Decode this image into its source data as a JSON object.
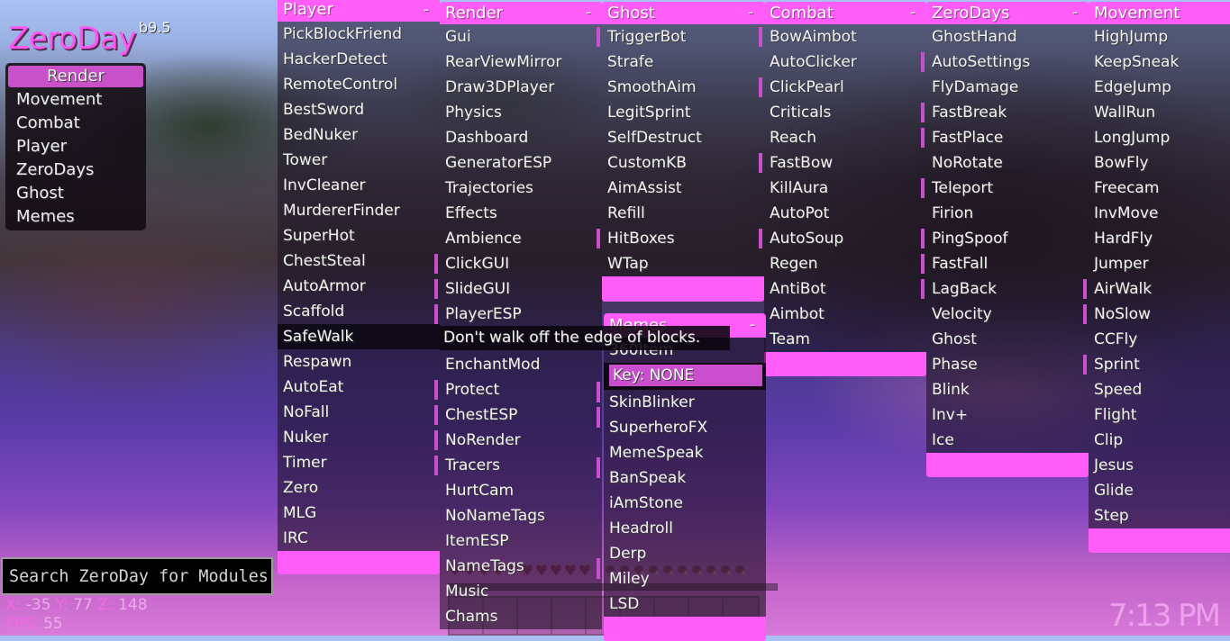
{
  "app": {
    "title": "ZeroDay",
    "version": "b9.5"
  },
  "colors": {
    "accent": "#ff5cf8",
    "enabled_indicator": "#c94fcf",
    "selected_category": "#c850c8",
    "logo": "#ff55f2"
  },
  "sidebar": {
    "categories": [
      {
        "label": "Render",
        "selected": true
      },
      {
        "label": "Movement"
      },
      {
        "label": "Combat"
      },
      {
        "label": "Player"
      },
      {
        "label": "ZeroDays"
      },
      {
        "label": "Ghost"
      },
      {
        "label": "Memes"
      }
    ]
  },
  "panels": [
    {
      "id": "player",
      "title": "Player",
      "collapse_symbol": "-",
      "items": [
        {
          "label": "PickBlockFriend"
        },
        {
          "label": "HackerDetect"
        },
        {
          "label": "RemoteControl"
        },
        {
          "label": "BestSword"
        },
        {
          "label": "BedNuker"
        },
        {
          "label": "Tower"
        },
        {
          "label": "InvCleaner"
        },
        {
          "label": "MurdererFinder"
        },
        {
          "label": "SuperHot"
        },
        {
          "label": "ChestSteal"
        },
        {
          "label": "AutoArmor"
        },
        {
          "label": "Scaffold"
        },
        {
          "label": "SafeWalk",
          "hovered": true
        },
        {
          "label": "Respawn"
        },
        {
          "label": "AutoEat"
        },
        {
          "label": "NoFall"
        },
        {
          "label": "Nuker"
        },
        {
          "label": "Timer"
        },
        {
          "label": "Zero"
        },
        {
          "label": "MLG"
        },
        {
          "label": "IRC"
        }
      ]
    },
    {
      "id": "render",
      "title": "Render",
      "collapse_symbol": "-",
      "items": [
        {
          "label": "Gui"
        },
        {
          "label": "RearViewMirror"
        },
        {
          "label": "Draw3DPlayer"
        },
        {
          "label": "Physics"
        },
        {
          "label": "Dashboard"
        },
        {
          "label": "GeneratorESP"
        },
        {
          "label": "Trajectories"
        },
        {
          "label": "Effects"
        },
        {
          "label": "Ambience"
        },
        {
          "label": "ClickGUI",
          "enabled": true
        },
        {
          "label": "SlideGUI",
          "enabled": true
        },
        {
          "label": "PlayerESP",
          "enabled": true
        },
        {
          "label": ""
        },
        {
          "label": "EnchantMod"
        },
        {
          "label": "Protect",
          "enabled": true
        },
        {
          "label": "ChestESP",
          "enabled": true
        },
        {
          "label": "NoRender",
          "enabled": true
        },
        {
          "label": "Tracers",
          "enabled": true
        },
        {
          "label": "HurtCam"
        },
        {
          "label": "NoNameTags"
        },
        {
          "label": "ItemESP"
        },
        {
          "label": "NameTags"
        },
        {
          "label": "Music"
        },
        {
          "label": "Chams"
        }
      ]
    },
    {
      "id": "ghost",
      "title": "Ghost",
      "collapse_symbol": "-",
      "items": [
        {
          "label": "TriggerBot",
          "enabled": true
        },
        {
          "label": "Strafe"
        },
        {
          "label": "SmoothAim"
        },
        {
          "label": "LegitSprint"
        },
        {
          "label": "SelfDestruct"
        },
        {
          "label": "CustomKB"
        },
        {
          "label": "AimAssist"
        },
        {
          "label": "Refill"
        },
        {
          "label": "HitBoxes",
          "enabled": true
        },
        {
          "label": "WTap"
        }
      ]
    },
    {
      "id": "combat",
      "title": "Combat",
      "collapse_symbol": "-",
      "items": [
        {
          "label": "BowAimbot",
          "enabled": true
        },
        {
          "label": "AutoClicker"
        },
        {
          "label": "ClickPearl",
          "enabled": true
        },
        {
          "label": "Criticals"
        },
        {
          "label": "Reach"
        },
        {
          "label": "FastBow",
          "enabled": true
        },
        {
          "label": "KillAura"
        },
        {
          "label": "AutoPot"
        },
        {
          "label": "AutoSoup",
          "enabled": true
        },
        {
          "label": "Regen"
        },
        {
          "label": "AntiBot"
        },
        {
          "label": "Aimbot"
        },
        {
          "label": "Team"
        }
      ]
    },
    {
      "id": "zerodays",
      "title": "ZeroDays",
      "collapse_symbol": "-",
      "items": [
        {
          "label": "GhostHand"
        },
        {
          "label": "AutoSettings",
          "enabled": true
        },
        {
          "label": "FlyDamage"
        },
        {
          "label": "FastBreak",
          "enabled": true
        },
        {
          "label": "FastPlace",
          "enabled": true
        },
        {
          "label": "NoRotate"
        },
        {
          "label": "Teleport",
          "enabled": true
        },
        {
          "label": "Firion"
        },
        {
          "label": "PingSpoof",
          "enabled": true
        },
        {
          "label": "FastFall",
          "enabled": true
        },
        {
          "label": "LagBack",
          "enabled": true
        },
        {
          "label": "Velocity"
        },
        {
          "label": "Ghost"
        },
        {
          "label": "Phase"
        },
        {
          "label": "Blink"
        },
        {
          "label": "Inv+"
        },
        {
          "label": "Ice"
        }
      ]
    },
    {
      "id": "movement",
      "title": "Movement",
      "items": [
        {
          "label": "HighJump"
        },
        {
          "label": "KeepSneak"
        },
        {
          "label": "EdgeJump"
        },
        {
          "label": "WallRun"
        },
        {
          "label": "LongJump"
        },
        {
          "label": "BowFly"
        },
        {
          "label": "Freecam"
        },
        {
          "label": "InvMove"
        },
        {
          "label": "HardFly"
        },
        {
          "label": "Jumper"
        },
        {
          "label": "AirWalk",
          "enabled": true
        },
        {
          "label": "NoSlow",
          "enabled": true
        },
        {
          "label": "CCFly"
        },
        {
          "label": "Sprint",
          "enabled": true
        },
        {
          "label": "Speed"
        },
        {
          "label": "Flight"
        },
        {
          "label": "Clip"
        },
        {
          "label": "Jesus"
        },
        {
          "label": "Glide"
        },
        {
          "label": "Step"
        }
      ]
    },
    {
      "id": "memes",
      "title": "Memes",
      "collapse_symbol": "-",
      "items": [
        {
          "label": "360Item",
          "setting": "Key: NONE"
        },
        {
          "label": "SkinBlinker",
          "enabled": true
        },
        {
          "label": "SuperheroFX",
          "enabled": true
        },
        {
          "label": "MemeSpeak"
        },
        {
          "label": "BanSpeak",
          "enabled": true
        },
        {
          "label": "iAmStone"
        },
        {
          "label": "Headroll"
        },
        {
          "label": "Derp"
        },
        {
          "label": "Miley",
          "enabled": true
        },
        {
          "label": "LSD"
        }
      ]
    }
  ],
  "tooltip": {
    "text": "Don't walk off the edge of blocks."
  },
  "search": {
    "placeholder": "Search ZeroDay for Modules",
    "value": ""
  },
  "hud": {
    "x_label": "X:",
    "x": "-35",
    "y_label": "Y:",
    "y": "77",
    "z_label": "Z:",
    "z": "148",
    "fps_label": "FPS:",
    "fps": "55",
    "clock": "7:13 PM",
    "hearts": 10,
    "hunger": 10,
    "hotbar_slots": 9
  }
}
